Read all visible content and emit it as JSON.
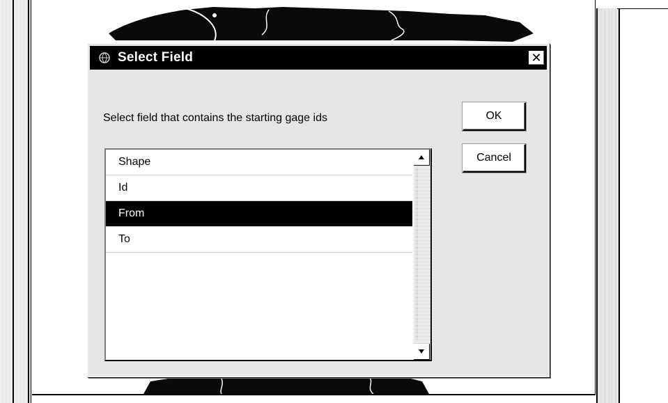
{
  "dialog": {
    "title": "Select Field",
    "close_label": "✕",
    "prompt": "Select field that contains the starting gage ids",
    "ok_label": "OK",
    "cancel_label": "Cancel",
    "fields": [
      "Shape",
      "Id",
      "From",
      "To"
    ],
    "selected_field": "From"
  },
  "icons": {
    "title": "app-globe-icon",
    "scroll_up": "scroll-up-arrow-icon",
    "scroll_down": "scroll-down-arrow-icon"
  }
}
